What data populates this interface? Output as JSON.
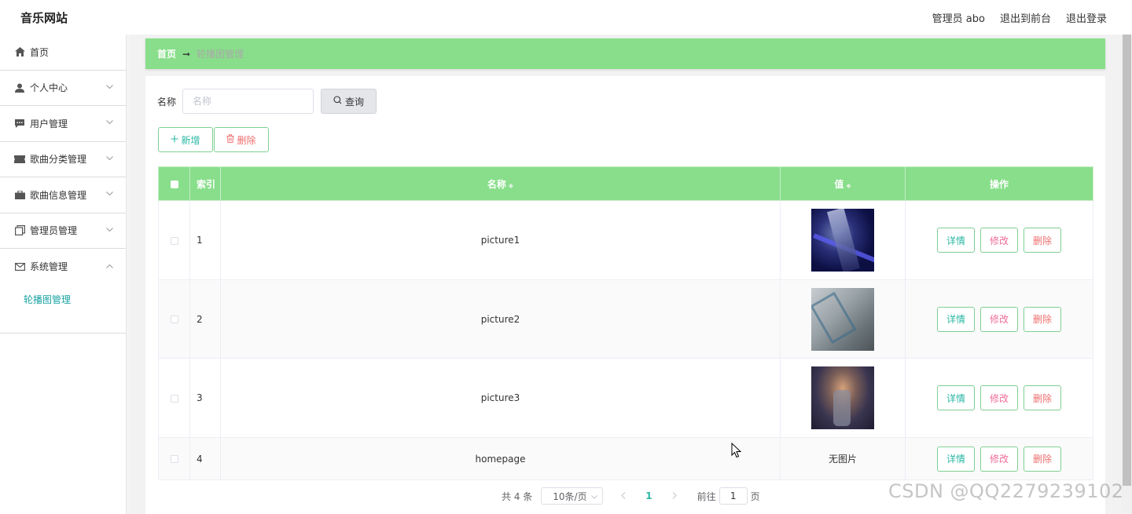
{
  "header": {
    "site_title": "音乐网站",
    "links": [
      "管理员 abo",
      "退出到前台",
      "退出登录"
    ]
  },
  "sidebar": {
    "items": [
      {
        "label": "首页",
        "icon": "home-icon",
        "has_chevron": false
      },
      {
        "label": "个人中心",
        "icon": "user-icon",
        "has_chevron": true
      },
      {
        "label": "用户管理",
        "icon": "chat-icon",
        "has_chevron": true
      },
      {
        "label": "歌曲分类管理",
        "icon": "ticket-icon",
        "has_chevron": true
      },
      {
        "label": "歌曲信息管理",
        "icon": "briefcase-icon",
        "has_chevron": true
      },
      {
        "label": "管理员管理",
        "icon": "copy-icon",
        "has_chevron": true
      },
      {
        "label": "系统管理",
        "icon": "mail-icon",
        "has_chevron": true,
        "expanded": true
      }
    ],
    "submenu": [
      "轮播图管理"
    ],
    "active_color": "#1aa3a3"
  },
  "breadcrumb": {
    "home": "首页",
    "separator": "➞",
    "current": "轮播图管理"
  },
  "search": {
    "label": "名称",
    "placeholder": "名称",
    "value": "",
    "button_label": "查询"
  },
  "actions": {
    "add_label": "新增",
    "delete_label": "删除"
  },
  "table": {
    "columns": [
      "索引",
      "名称",
      "值",
      "操作"
    ],
    "rows": [
      {
        "index": "1",
        "name": "picture1",
        "value": "image",
        "image": "thumb1"
      },
      {
        "index": "2",
        "name": "picture2",
        "value": "image",
        "image": "thumb2"
      },
      {
        "index": "3",
        "name": "picture3",
        "value": "image",
        "image": "thumb3"
      },
      {
        "index": "4",
        "name": "homepage",
        "value": "无图片",
        "image": null
      }
    ],
    "row_buttons": {
      "detail": "详情",
      "edit": "修改",
      "delete": "删除"
    },
    "header_color": "#88de8a"
  },
  "pagination": {
    "total_text": "共 4 条",
    "page_size": "10条/页",
    "current_page": "1",
    "goto_label": "前往",
    "goto_value": "1",
    "page_suffix": "页"
  },
  "watermark": "CSDN @QQ2279239102",
  "colors": {
    "accent_green": "#88de8a",
    "teal": "#2ab7a4",
    "pink": "#f06b9a",
    "red": "#ef6f6f"
  }
}
